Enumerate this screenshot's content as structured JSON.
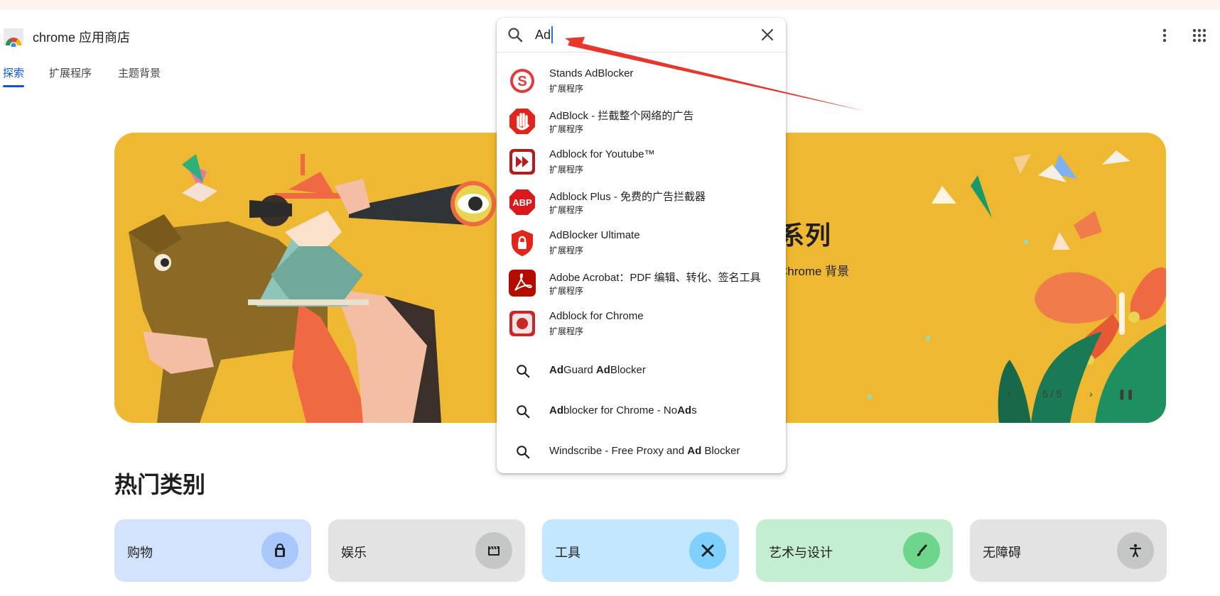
{
  "header": {
    "brand": "chrome 应用商店",
    "nav": [
      {
        "label": "探索",
        "active": true
      },
      {
        "label": "扩展程序"
      },
      {
        "label": "主题背景"
      }
    ],
    "icons": [
      "more-vert-icon",
      "apps-grid-icon"
    ]
  },
  "hero": {
    "title_partial": "系列",
    "subtitle_partial": "Chrome 背景",
    "pager": "5 / 5"
  },
  "search": {
    "value": "Ad",
    "results": [
      {
        "name": "Stands AdBlocker",
        "type": "扩展程序"
      },
      {
        "name": "AdBlock - 拦截整个网络的广告",
        "type": "扩展程序"
      },
      {
        "name": "Adblock for Youtube™",
        "type": "扩展程序"
      },
      {
        "name": "Adblock Plus - 免费的广告拦截器",
        "type": "扩展程序"
      },
      {
        "name": "AdBlocker Ultimate",
        "type": "扩展程序"
      },
      {
        "name": "Adobe Acrobat：PDF 编辑、转化、签名工具",
        "type": "扩展程序"
      },
      {
        "name": "Adblock for Chrome",
        "type": "扩展程序"
      }
    ],
    "suggestions": [
      [
        {
          "t": "Ad",
          "b": true
        },
        {
          "t": "Guard ",
          "b": false
        },
        {
          "t": "Ad",
          "b": true
        },
        {
          "t": "Blocker",
          "b": false
        }
      ],
      [
        {
          "t": "Ad",
          "b": true
        },
        {
          "t": "blocker for Chrome - No",
          "b": false
        },
        {
          "t": "Ad",
          "b": true
        },
        {
          "t": "s",
          "b": false
        }
      ],
      [
        {
          "t": "Windscribe - Free Proxy and ",
          "b": false
        },
        {
          "t": "Ad",
          "b": true
        },
        {
          "t": " Blocker",
          "b": false
        }
      ]
    ]
  },
  "categories": {
    "title": "热门类别",
    "items": [
      {
        "label": "购物",
        "bg": "#d3e3fd",
        "iconbg": "#a8c7fa"
      },
      {
        "label": "娱乐",
        "bg": "#e3e3e3",
        "iconbg": "#c4c7c5"
      },
      {
        "label": "工具",
        "bg": "#c2e7ff",
        "iconbg": "#7fcfff"
      },
      {
        "label": "艺术与设计",
        "bg": "#c4eed0",
        "iconbg": "#6dd58c"
      },
      {
        "label": "无障碍",
        "bg": "#e3e3e3",
        "iconbg": "#c4c7c5"
      }
    ]
  },
  "colors": {
    "accent": "#0b57d0",
    "hero": "#efb832",
    "annotation": "#e8362c"
  }
}
